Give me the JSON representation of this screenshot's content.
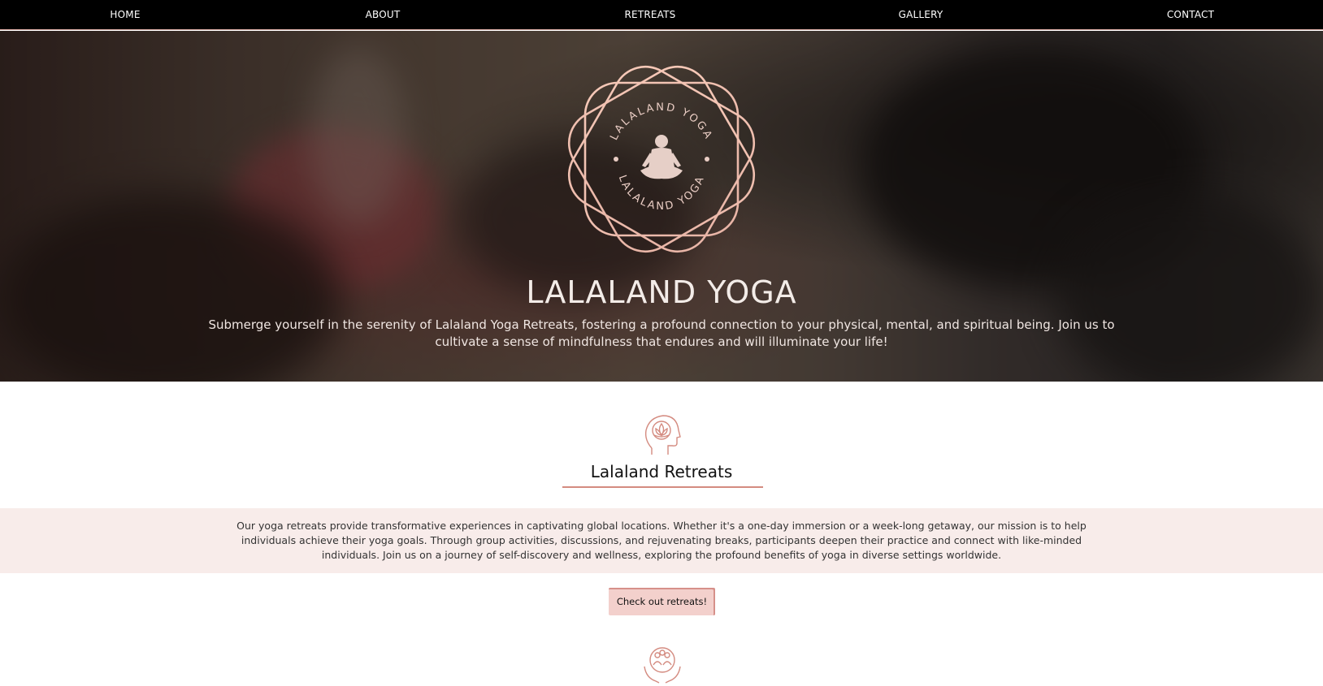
{
  "nav": {
    "items": [
      {
        "label": "HOME"
      },
      {
        "label": "ABOUT"
      },
      {
        "label": "RETREATS"
      },
      {
        "label": "GALLERY"
      },
      {
        "label": "CONTACT"
      }
    ]
  },
  "hero": {
    "logo_ring_text": "LALALAND YOGA",
    "title": "LALALAND YOGA",
    "subtitle": "Submerge yourself in the serenity of Lalaland Yoga Retreats, fostering a profound connection to your physical, mental, and spiritual being. Join us to cultivate a sense of mindfulness that endures and will illuminate your life!"
  },
  "retreats": {
    "icon": "mind-lotus-icon",
    "title": "Lalaland Retreats",
    "description": "Our yoga retreats provide transformative experiences in captivating global locations. Whether it's a one-day immersion or a week-long getaway, our mission is to help individuals achieve their yoga goals. Through group activities, discussions, and rejuvenating breaks, participants deepen their practice and connect with like-minded individuals. Join us on a journey of self-discovery and wellness, exploring the profound benefits of yoga in diverse settings worldwide.",
    "cta_label": "Check out retreats!"
  },
  "next_section": {
    "icon": "community-hands-icon"
  },
  "colors": {
    "accent": "#d48b80",
    "band_bg": "#f8ecea",
    "button_bg": "#f3d0cc",
    "nav_bg": "#000000"
  }
}
